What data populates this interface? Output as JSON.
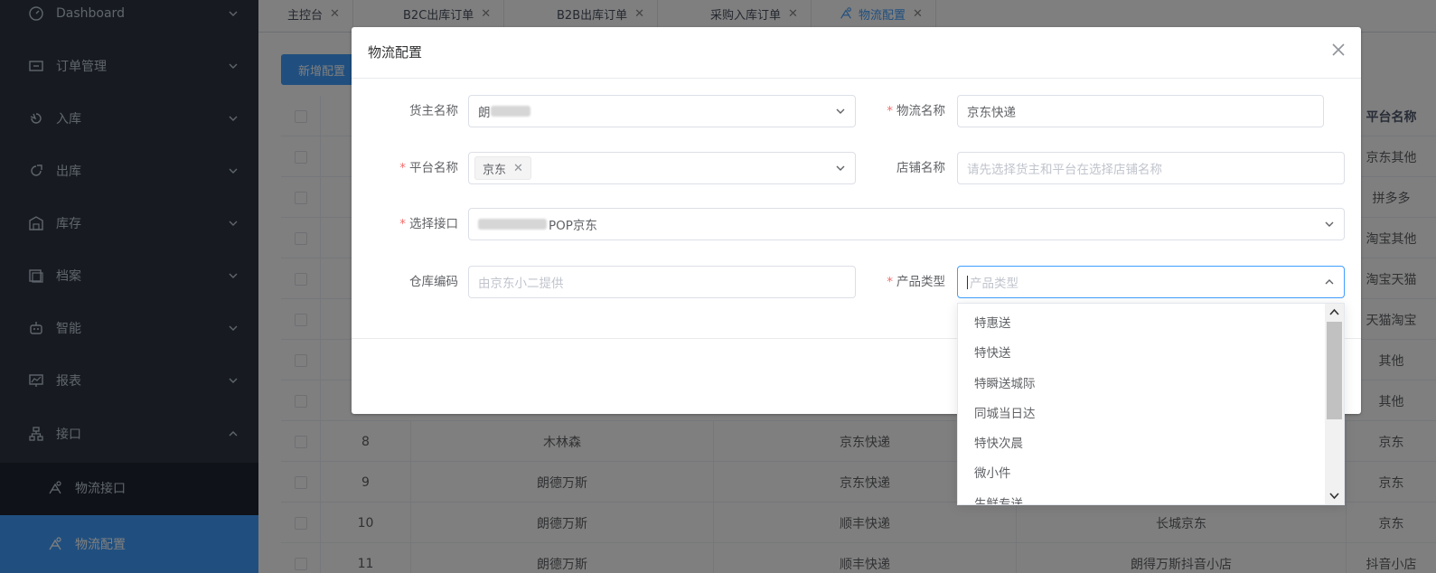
{
  "sidebar": {
    "items": [
      {
        "label": "Dashboard",
        "icon": "dashboard-icon"
      },
      {
        "label": "订单管理",
        "icon": "order-icon"
      },
      {
        "label": "入库",
        "icon": "inbound-icon"
      },
      {
        "label": "出库",
        "icon": "outbound-icon"
      },
      {
        "label": "库存",
        "icon": "warehouse-icon"
      },
      {
        "label": "档案",
        "icon": "archive-icon"
      },
      {
        "label": "智能",
        "icon": "robot-icon"
      },
      {
        "label": "报表",
        "icon": "report-icon"
      },
      {
        "label": "接口",
        "icon": "api-icon"
      }
    ],
    "sub_items": [
      {
        "label": "物流接口",
        "icon": "logistics-icon"
      },
      {
        "label": "物流配置",
        "icon": "logistics-config-icon"
      }
    ]
  },
  "tabs": [
    {
      "label": "主控台"
    },
    {
      "label": "B2C出库订单"
    },
    {
      "label": "B2B出库订单"
    },
    {
      "label": "采购入库订单"
    },
    {
      "label": "物流配置"
    }
  ],
  "toolbar": {
    "add_label": "新增配置"
  },
  "table": {
    "header_right": "平台名称",
    "right_col": [
      "京东其他",
      "拼多多",
      "淘宝其他",
      "淘宝天猫",
      "天猫淘宝",
      "其他",
      "其他"
    ],
    "rows": [
      {
        "no": "8",
        "owner": "木林森",
        "logistics": "京东快递",
        "shop": "",
        "platform": "京东"
      },
      {
        "no": "9",
        "owner": "朗德万斯",
        "logistics": "京东快递",
        "shop": "",
        "platform": "京东"
      },
      {
        "no": "10",
        "owner": "朗德万斯",
        "logistics": "顺丰快递",
        "shop": "长城京东",
        "platform": "京东"
      },
      {
        "no": "11",
        "owner": "朗德万斯",
        "logistics": "顺丰快递",
        "shop": "朗得万斯抖音小店",
        "platform": "抖音小店"
      }
    ]
  },
  "dialog": {
    "title": "物流配置",
    "fields": {
      "owner_label": "货主名称",
      "owner_value_prefix": "朗",
      "logistics_label": "物流名称",
      "logistics_value": "京东快递",
      "platform_label": "平台名称",
      "platform_tag": "京东",
      "shop_label": "店铺名称",
      "shop_placeholder": "请先选择货主和平台在选择店铺名称",
      "api_label": "选择接口",
      "api_value_suffix": "POP京东",
      "warehouse_label": "仓库编码",
      "warehouse_placeholder": "由京东小二提供",
      "product_label": "产品类型",
      "product_placeholder": "产品类型"
    }
  },
  "dropdown": {
    "options": [
      "特惠送",
      "特快送",
      "特瞬送城际",
      "同城当日达",
      "特快次晨",
      "微小件",
      "生鲜专送"
    ]
  },
  "colors": {
    "sidebar_bg": "#2f3542",
    "accent": "#409eff",
    "required": "#f56c6c"
  }
}
